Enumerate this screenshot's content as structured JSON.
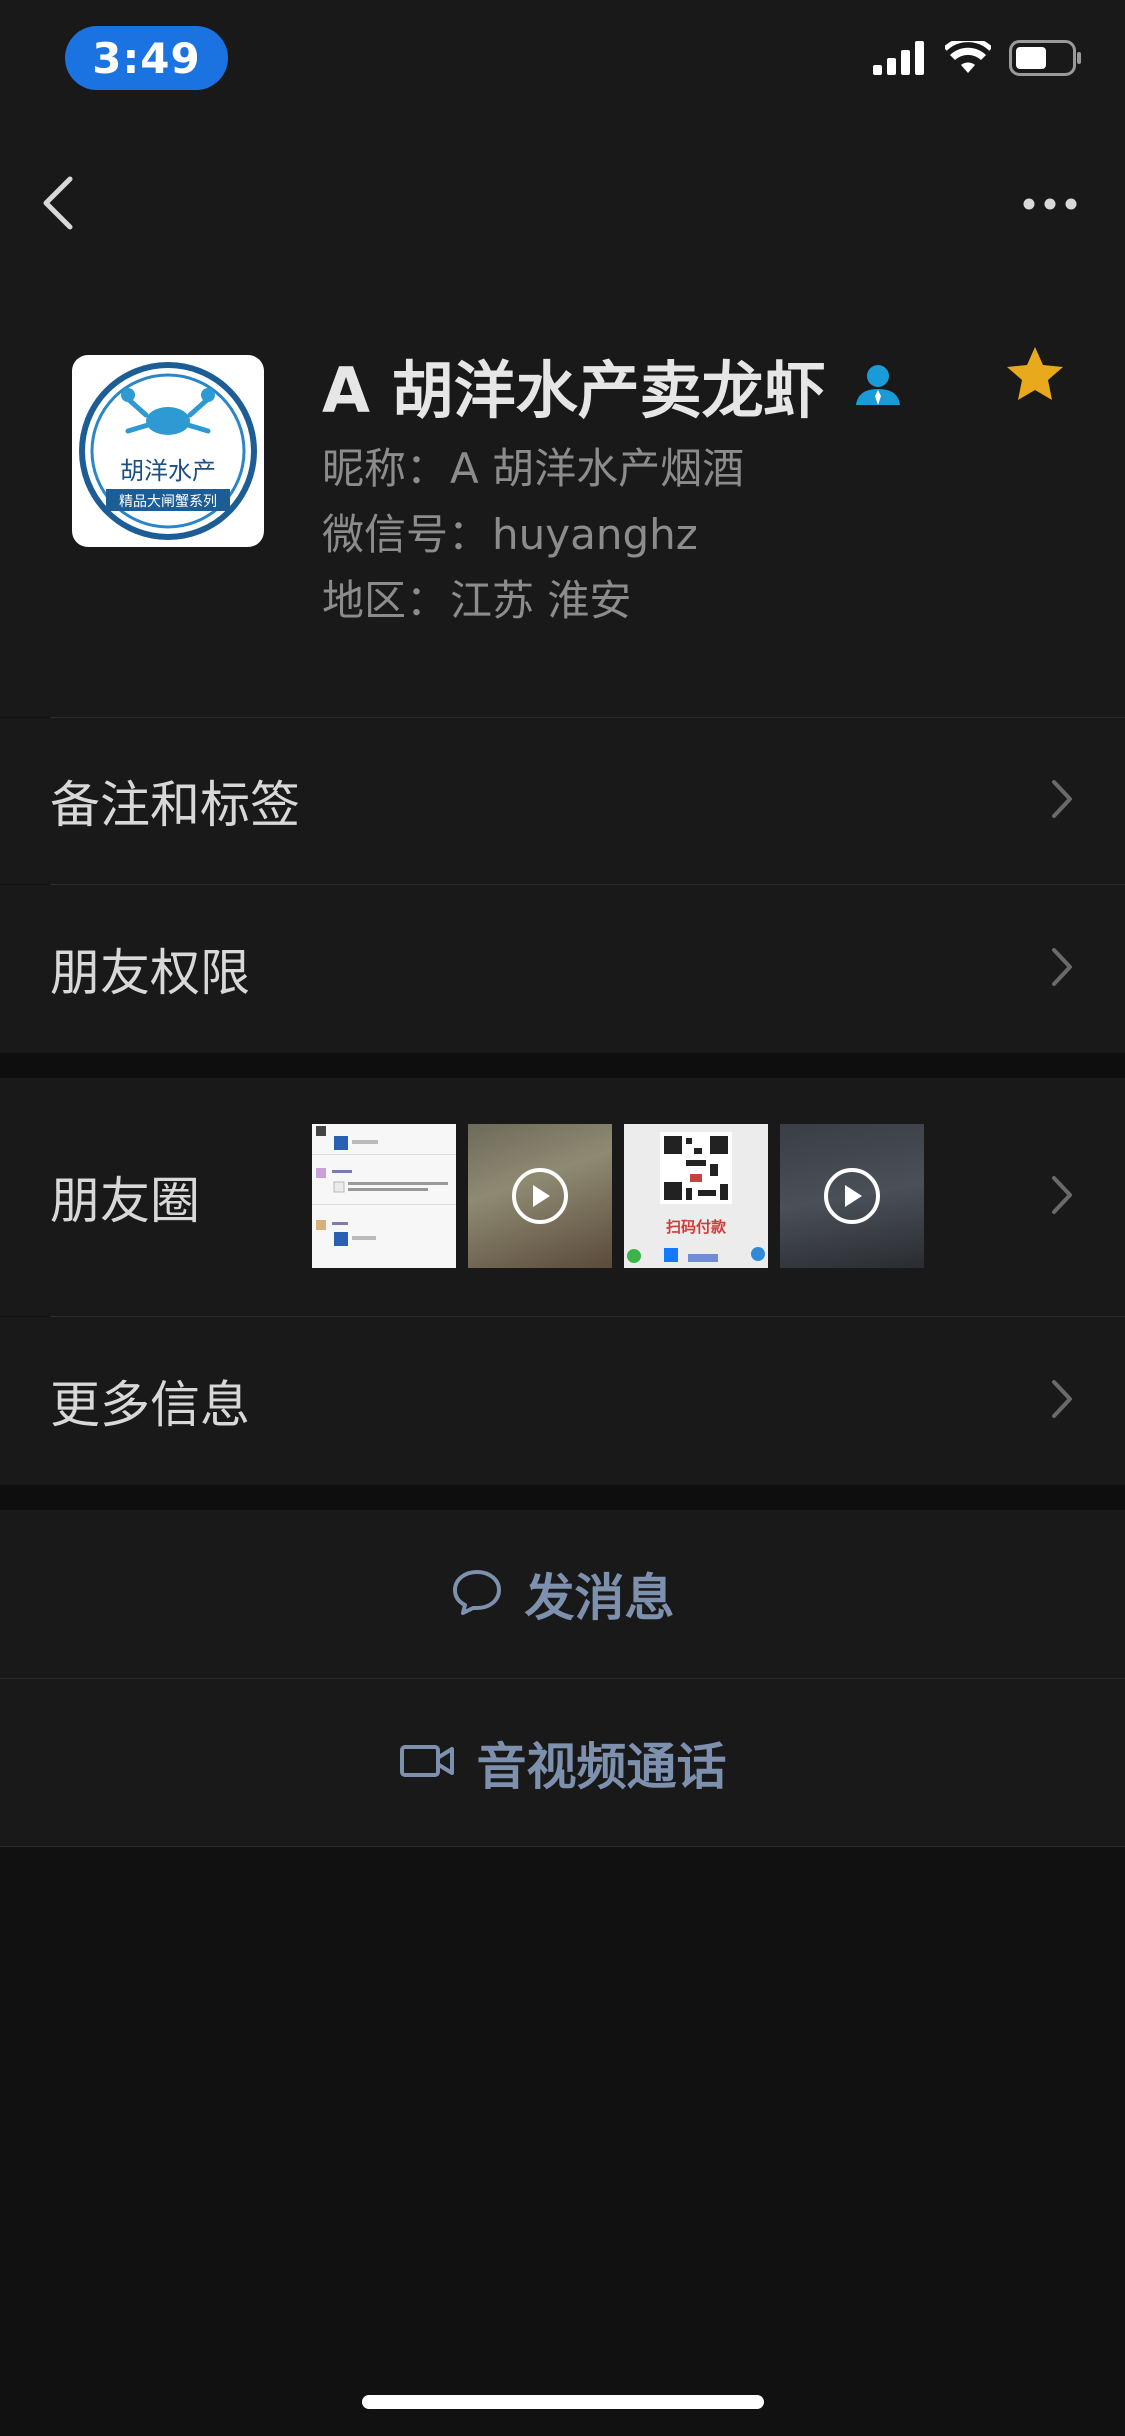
{
  "status_bar": {
    "time": "3:49",
    "signal_icon": "signal-bars-icon",
    "wifi_icon": "wifi-icon",
    "battery_icon": "battery-icon"
  },
  "nav": {
    "back_icon": "chevron-left-icon",
    "more_icon": "more-dots-icon"
  },
  "profile": {
    "name": "A 胡洋水产卖龙虾",
    "nickname_label": "昵称：",
    "nickname": "A 胡洋水产烟酒",
    "wechat_id_label": "微信号：",
    "wechat_id": "huyanghz",
    "region_label": "地区：",
    "region": "江苏 淮安",
    "avatar_text_top": "胡洋水产",
    "avatar_text_bottom": "精品大闸蟹系列",
    "contact_icon": "contact-person-icon",
    "star_icon": "star-icon",
    "colors": {
      "star": "#e8a91c",
      "contact_icon": "#1a9bd7"
    }
  },
  "menu": {
    "remark_tags": "备注和标签",
    "friend_permissions": "朋友权限",
    "moments": "朋友圈",
    "more_info": "更多信息"
  },
  "moments_thumbs": [
    {
      "type": "image",
      "desc": "chat screenshot"
    },
    {
      "type": "video",
      "desc": "video"
    },
    {
      "type": "image",
      "desc": "qr payment",
      "caption": "扫码付款"
    },
    {
      "type": "video",
      "desc": "video"
    }
  ],
  "actions": {
    "send_message": "发消息",
    "send_message_icon": "chat-bubble-icon",
    "av_call": "音视频通话",
    "av_call_icon": "video-camera-icon",
    "accent_color": "#7d90ad"
  }
}
